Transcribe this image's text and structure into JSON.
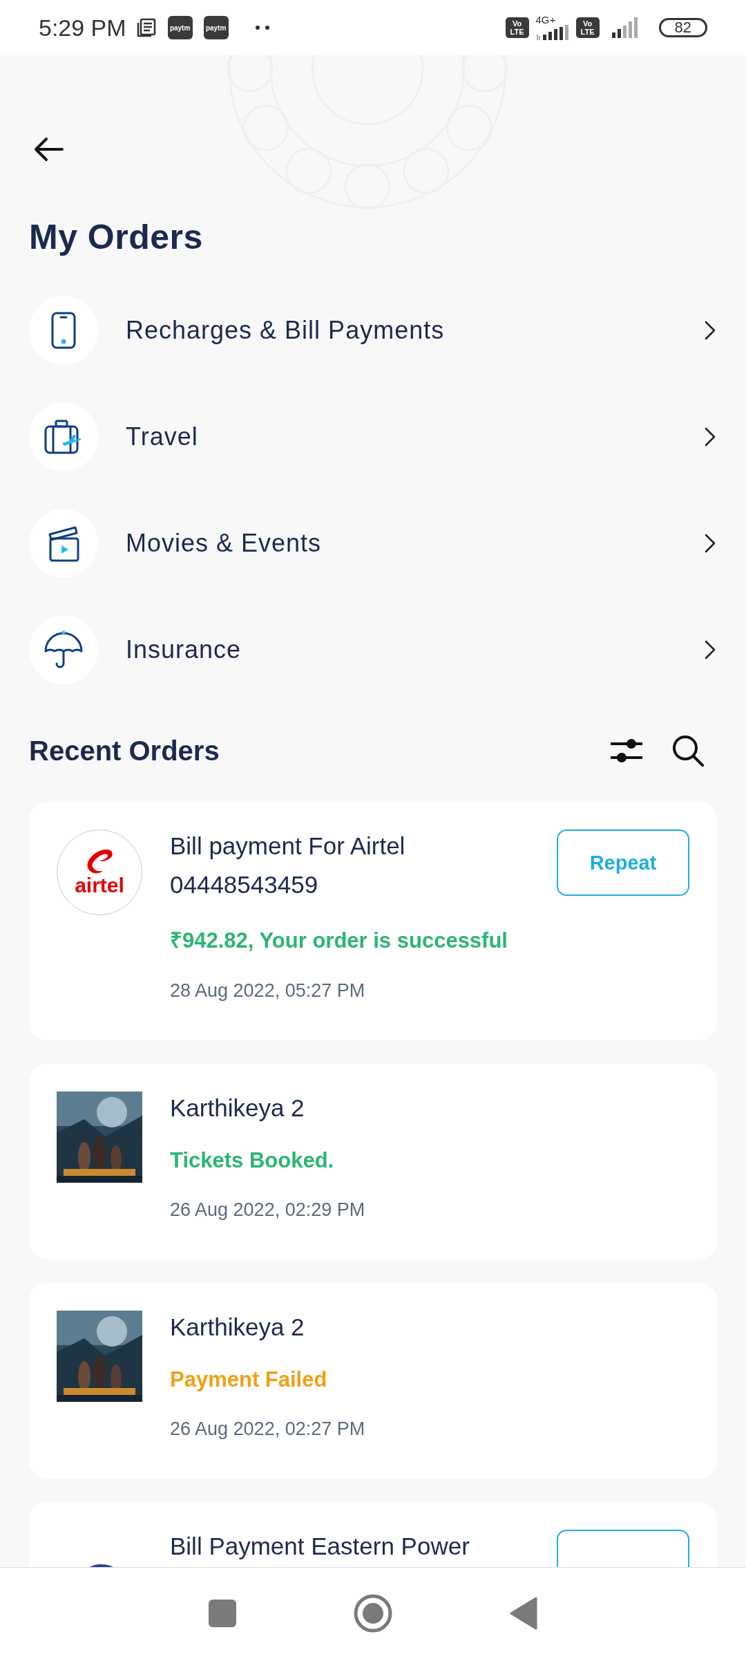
{
  "status_bar": {
    "time": "5:29 PM",
    "app_badges": [
      "paytm",
      "paytm"
    ],
    "sims": [
      {
        "badge_top": "Vo",
        "badge_bottom": "LTE",
        "network": "4G+"
      },
      {
        "badge_top": "Vo",
        "badge_bottom": "LTE"
      }
    ],
    "battery": "82"
  },
  "title": "My Orders",
  "categories": [
    {
      "kind": "phone",
      "label": "Recharges & Bill Payments"
    },
    {
      "kind": "travel",
      "label": "Travel"
    },
    {
      "kind": "movie",
      "label": "Movies & Events"
    },
    {
      "kind": "insurance",
      "label": "Insurance"
    }
  ],
  "recent": {
    "title": "Recent Orders"
  },
  "orders": [
    {
      "kind": "airtel",
      "logo_text": "airtel",
      "title": "Bill payment For Airtel 04448543459",
      "status": "₹942.82, Your order is successful",
      "color": "#2bb673",
      "date": "28 Aug 2022, 05:27 PM",
      "button_shown": true,
      "button_label": "Repeat"
    },
    {
      "kind": "picture",
      "title": "Karthikeya 2",
      "status": "Tickets Booked.",
      "color": "#2bb673",
      "date": "26 Aug 2022, 02:29 PM",
      "button_shown": false
    },
    {
      "kind": "picture",
      "title": "Karthikeya 2",
      "status": "Payment Failed",
      "color": "#f0a015",
      "date": "26 Aug 2022, 02:27 PM",
      "button_shown": false
    },
    {
      "kind": "logo",
      "title": "Bill Payment Eastern Power",
      "button_shown": true
    }
  ]
}
